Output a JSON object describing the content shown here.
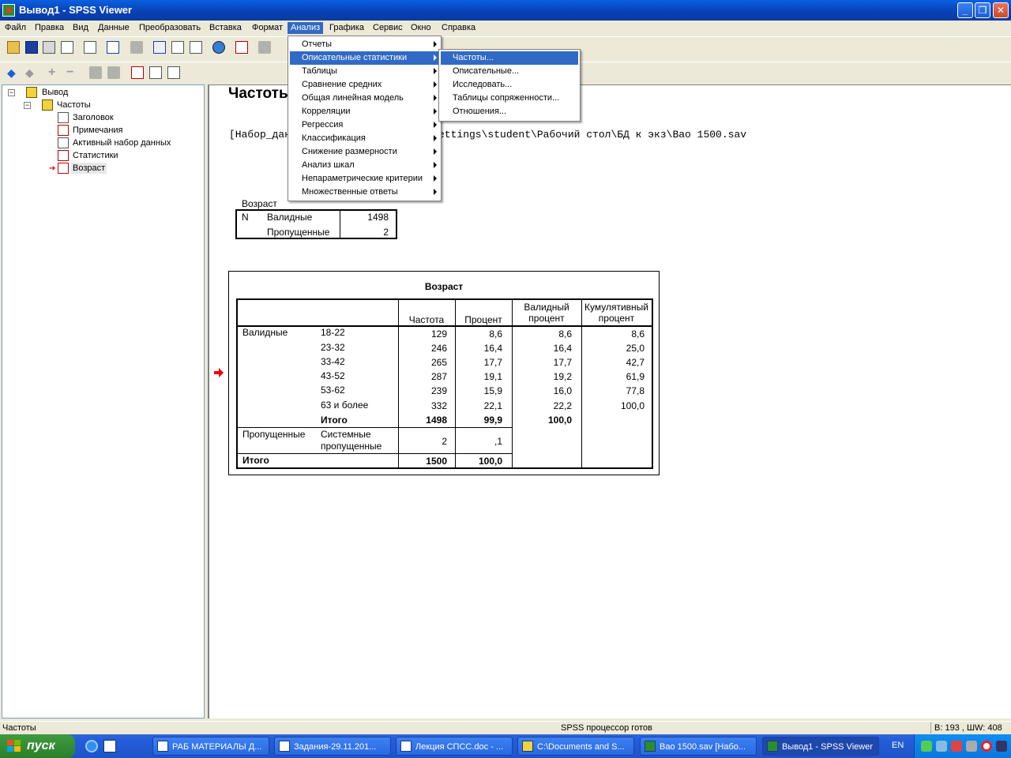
{
  "window": {
    "title": "Вывод1 - SPSS Viewer"
  },
  "menubar": [
    "Файл",
    "Правка",
    "Вид",
    "Данные",
    "Преобразовать",
    "Вставка",
    "Формат",
    "Анализ",
    "Графика",
    "Сервис",
    "Окно",
    "Справка"
  ],
  "outline": {
    "root": "Вывод",
    "group": "Частоты",
    "items": [
      "Заголовок",
      "Примечания",
      "Активный набор данных",
      "Статистики",
      "Возраст"
    ]
  },
  "content": {
    "heading": "Частоты",
    "dataset_left": "[Набор_дан",
    "dataset_right": "ettings\\student\\Рабочий стол\\БД к экз\\Вао 1500.sav",
    "stats": {
      "title": "Возраст",
      "n_label": "N",
      "rows": [
        {
          "label": "Валидные",
          "value": "1498"
        },
        {
          "label": "Пропущенные",
          "value": "2"
        }
      ]
    },
    "freq": {
      "title": "Возраст",
      "headers": [
        "Частота",
        "Процент",
        "Валидный процент",
        "Кумулятивный процент"
      ],
      "valid_label": "Валидные",
      "rows": [
        {
          "cat": "18-22",
          "f": "129",
          "p": "8,6",
          "vp": "8,6",
          "cp": "8,6"
        },
        {
          "cat": "23-32",
          "f": "246",
          "p": "16,4",
          "vp": "16,4",
          "cp": "25,0"
        },
        {
          "cat": "33-42",
          "f": "265",
          "p": "17,7",
          "vp": "17,7",
          "cp": "42,7"
        },
        {
          "cat": "43-52",
          "f": "287",
          "p": "19,1",
          "vp": "19,2",
          "cp": "61,9"
        },
        {
          "cat": "53-62",
          "f": "239",
          "p": "15,9",
          "vp": "16,0",
          "cp": "77,8"
        },
        {
          "cat": "63 и более",
          "f": "332",
          "p": "22,1",
          "vp": "22,2",
          "cp": "100,0"
        }
      ],
      "valid_total": {
        "label": "Итого",
        "f": "1498",
        "p": "99,9",
        "vp": "100,0"
      },
      "missing": {
        "label": "Пропущенные",
        "sub1": "Системные",
        "sub2": "пропущенные",
        "f": "2",
        "p": ",1"
      },
      "total": {
        "label": "Итого",
        "f": "1500",
        "p": "100,0"
      }
    }
  },
  "analyze_menu": [
    "Отчеты",
    "Описательные статистики",
    "Таблицы",
    "Сравнение средних",
    "Общая линейная модель",
    "Корреляции",
    "Регрессия",
    "Классификация",
    "Снижение размерности",
    "Анализ шкал",
    "Непараметрические критерии",
    "Множественные ответы"
  ],
  "descriptives_submenu": [
    "Частоты...",
    "Описательные...",
    "Исследовать...",
    "Таблицы сопряженности...",
    "Отношения..."
  ],
  "statusbar": {
    "left": "Частоты",
    "center": "SPSS процессор готов",
    "right": "В: 193 , ШW: 408 "
  },
  "taskbar": {
    "start": "пуск",
    "tasks": [
      "РАБ МАТЕРИАЛЫ Д...",
      "Задания-29.11.201...",
      "Лекция СПСС.doc - ...",
      "C:\\Documents and S...",
      "Вао 1500.sav [Набо...",
      "Вывод1 - SPSS Viewer"
    ],
    "lang": "EN"
  }
}
